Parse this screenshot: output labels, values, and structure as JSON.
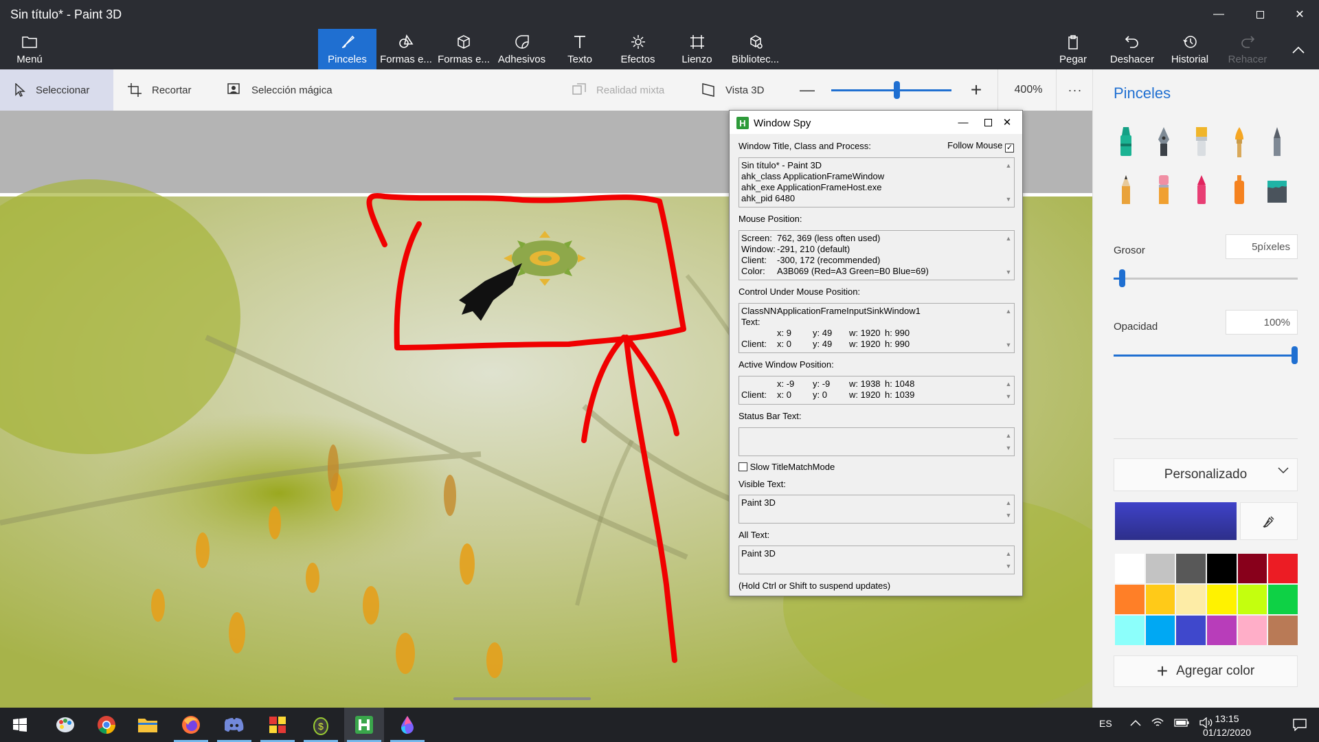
{
  "window": {
    "title": "Sin título* - Paint 3D"
  },
  "ribbon": {
    "menu_label": "Menú",
    "tools": [
      {
        "label": "Pinceles",
        "icon": "brush-icon",
        "active": true
      },
      {
        "label": "Formas e...",
        "icon": "shapes-2d-icon"
      },
      {
        "label": "Formas e...",
        "icon": "shapes-3d-icon"
      },
      {
        "label": "Adhesivos",
        "icon": "sticker-icon"
      },
      {
        "label": "Texto",
        "icon": "text-icon"
      },
      {
        "label": "Efectos",
        "icon": "effects-icon"
      },
      {
        "label": "Lienzo",
        "icon": "canvas-icon"
      },
      {
        "label": "Bibliotec...",
        "icon": "library-icon"
      }
    ],
    "actions": [
      {
        "label": "Pegar",
        "icon": "paste-icon"
      },
      {
        "label": "Deshacer",
        "icon": "undo-icon"
      },
      {
        "label": "Historial",
        "icon": "history-icon"
      },
      {
        "label": "Rehacer",
        "icon": "redo-icon",
        "disabled": true
      }
    ]
  },
  "toolbar": {
    "select_label": "Seleccionar",
    "crop_label": "Recortar",
    "magic_select_label": "Selección mágica",
    "mixed_reality_label": "Realidad mixta",
    "view3d_label": "Vista 3D",
    "zoom_value": "400%",
    "zoom_level": 0.55,
    "more_label": "···"
  },
  "panel": {
    "title": "Pinceles",
    "thickness_label": "Grosor",
    "thickness_value": "5píxeles",
    "thickness_level": 0.03,
    "opacity_label": "Opacidad",
    "opacity_value": "100%",
    "opacity_level": 1.0,
    "preset_label": "Personalizado",
    "current_color": "#3f42c8",
    "add_color_label": "Agregar color",
    "swatches": [
      "#ffffff",
      "#c3c3c3",
      "#585858",
      "#000000",
      "#88001b",
      "#ec1c24",
      "#ff7f27",
      "#ffca18",
      "#fdeca6",
      "#fff200",
      "#c4ff0e",
      "#0ed145",
      "#8cfffb",
      "#00a8f3",
      "#3f48cc",
      "#b83dba",
      "#ffaec8",
      "#b97a56"
    ]
  },
  "spy": {
    "title": "Window Spy",
    "sec_window": "Window Title, Class and Process:",
    "follow_mouse": "Follow Mouse",
    "window_lines": [
      "Sin título* - Paint 3D",
      "ahk_class ApplicationFrameWindow",
      "ahk_exe ApplicationFrameHost.exe",
      "ahk_pid 6480"
    ],
    "sec_mouse": "Mouse Position:",
    "mouse_rows": [
      {
        "k": "Screen:",
        "v": "762, 369 (less often used)"
      },
      {
        "k": "Window:",
        "v": "-291, 210 (default)"
      },
      {
        "k": "Client:",
        "v": "-300, 172 (recommended)"
      },
      {
        "k": "Color:",
        "v": "A3B069 (Red=A3 Green=B0 Blue=69)"
      }
    ],
    "sec_control": "Control Under Mouse Position:",
    "control_classnn": "ClassNN:",
    "control_classnn_val": "ApplicationFrameInputSinkWindow1",
    "control_text": "Text:",
    "control_row1": {
      "x": "x: 9",
      "y": "y: 49",
      "w": "w: 1920",
      "h": "h: 990"
    },
    "control_client": "Client:",
    "control_row2": {
      "x": "x: 0",
      "y": "y: 49",
      "w": "w: 1920",
      "h": "h: 990"
    },
    "sec_active": "Active Window Position:",
    "active_row1": {
      "x": "x: -9",
      "y": "y: -9",
      "w": "w: 1938",
      "h": "h: 1048"
    },
    "active_client": "Client:",
    "active_row2": {
      "x": "x: 0",
      "y": "y: 0",
      "w": "w: 1920",
      "h": "h: 1039"
    },
    "sec_status": "Status Bar Text:",
    "slow_mode": "Slow TitleMatchMode",
    "sec_visible": "Visible Text:",
    "visible_text": "Paint 3D",
    "sec_all": "All Text:",
    "all_text": "Paint 3D",
    "footer": "(Hold Ctrl or Shift to suspend updates)"
  },
  "taskbar": {
    "apps": [
      "start-icon",
      "paint-icon",
      "chrome-icon",
      "folder-icon",
      "firefox-icon",
      "discord-icon",
      "office-icon",
      "coin-icon",
      "autohotkey-icon",
      "paint3d-icon"
    ],
    "lang": "ES",
    "time": "13:15",
    "date": "01/12/2020"
  }
}
